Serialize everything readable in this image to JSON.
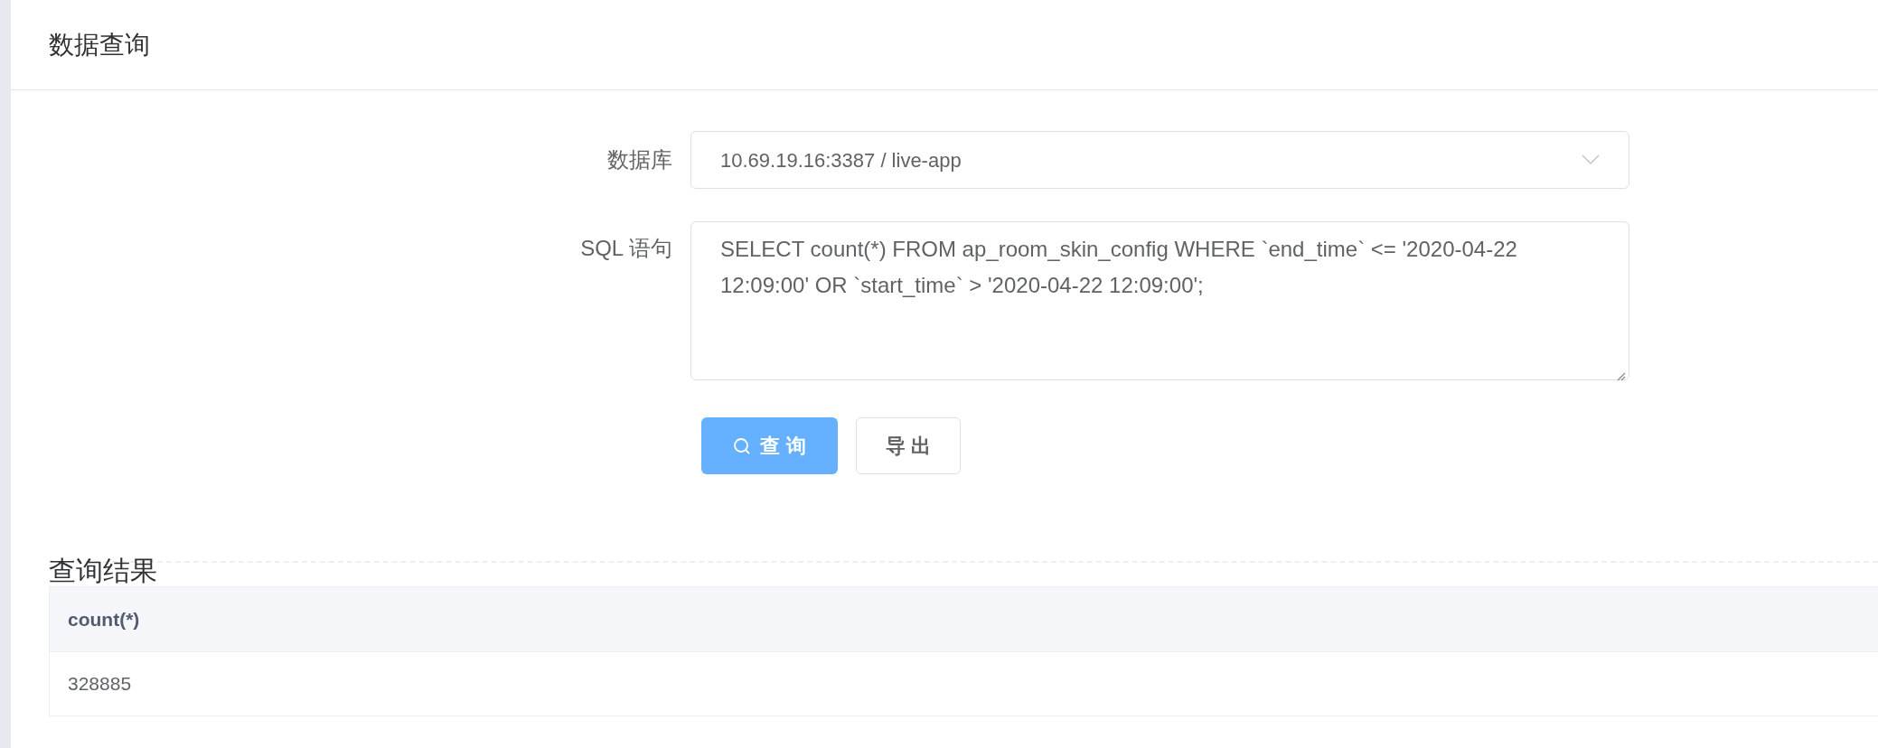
{
  "page_title": "数据查询",
  "form": {
    "database": {
      "label": "数据库",
      "value": "10.69.19.16:3387 / live-app"
    },
    "sql": {
      "label": "SQL 语句",
      "value": "SELECT count(*) FROM ap_room_skin_config WHERE `end_time` <= '2020-04-22 12:09:00' OR `start_time` > '2020-04-22 12:09:00';"
    },
    "buttons": [
      {
        "label": "查 询",
        "kind": "primary"
      },
      {
        "label": "导 出",
        "kind": "default"
      }
    ]
  },
  "results": {
    "title": "查询结果",
    "table": {
      "columns": [
        "count(*)"
      ],
      "rows": [
        [
          "328885"
        ]
      ]
    }
  }
}
